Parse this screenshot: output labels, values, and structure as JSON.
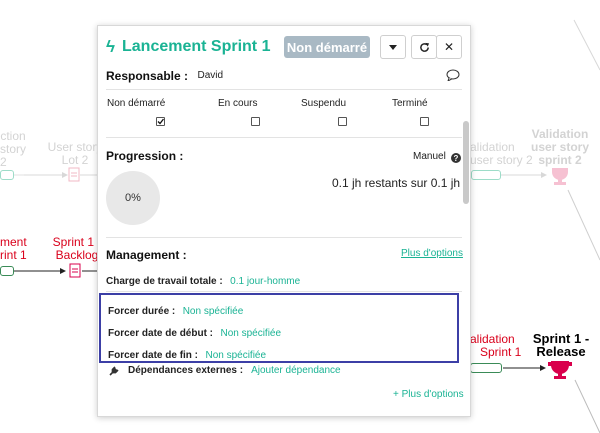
{
  "colors": {
    "accent": "#1ab394",
    "status_grey": "#a9b9c4",
    "highlight": "#3c3fa6",
    "red": "#d9001b",
    "trophy": "#d9004c"
  },
  "background": {
    "nodes": {
      "left_top_label_1": "ction",
      "left_top_label_2": "story",
      "left_top_label_3": "2",
      "user_story_1": "User story",
      "user_story_2": "Lot 2",
      "left_red_1": "ment",
      "left_red_2": "rint 1",
      "sprint_1": "Sprint 1 -",
      "backlog": "Backlog",
      "right_faded_1": "alidation",
      "right_faded_2": "user story 2",
      "validation_1": "Validation",
      "validation_2": "user story",
      "validation_3": "sprint 2",
      "right_red_1": "alidation",
      "right_red_2": "Sprint 1",
      "release_1": "Sprint 1 -",
      "release_2": "Release"
    }
  },
  "panel": {
    "title": "Lancement Sprint 1",
    "bolt_icon": "bolt-icon",
    "status_button": "Non démarré",
    "dropdown_icon": "caret-down-icon",
    "refresh_icon": "refresh-icon",
    "close_icon": "close-icon",
    "responsable_label": "Responsable :",
    "responsable_value": "David",
    "comment_icon": "comment-icon",
    "status_options": [
      {
        "label": "Non démarré",
        "checked": true
      },
      {
        "label": "En cours",
        "checked": false
      },
      {
        "label": "Suspendu",
        "checked": false
      },
      {
        "label": "Terminé",
        "checked": false
      }
    ],
    "progression_label": "Progression :",
    "manuel_label": "Manuel",
    "help_icon": "question-circle-icon",
    "remaining_text": "0.1 jh restants sur 0.1 jh",
    "progress_percent": "0%",
    "management_label": "Management :",
    "plus_options_top": "Plus d'options",
    "charge_label": "Charge de travail totale :",
    "charge_value": "0.1 jour-homme",
    "forcer_duree_label": "Forcer durée :",
    "forcer_duree_value": "Non spécifiée",
    "forcer_debut_label": "Forcer date de début :",
    "forcer_debut_value": "Non spécifiée",
    "forcer_fin_label": "Forcer date de fin :",
    "forcer_fin_value": "Non spécifiée",
    "dep_icon": "plug-icon",
    "dependances_label": "Dépendances externes :",
    "ajouter_dependance": "Ajouter dépendance",
    "plus_options_bottom": "+ Plus d'options"
  }
}
